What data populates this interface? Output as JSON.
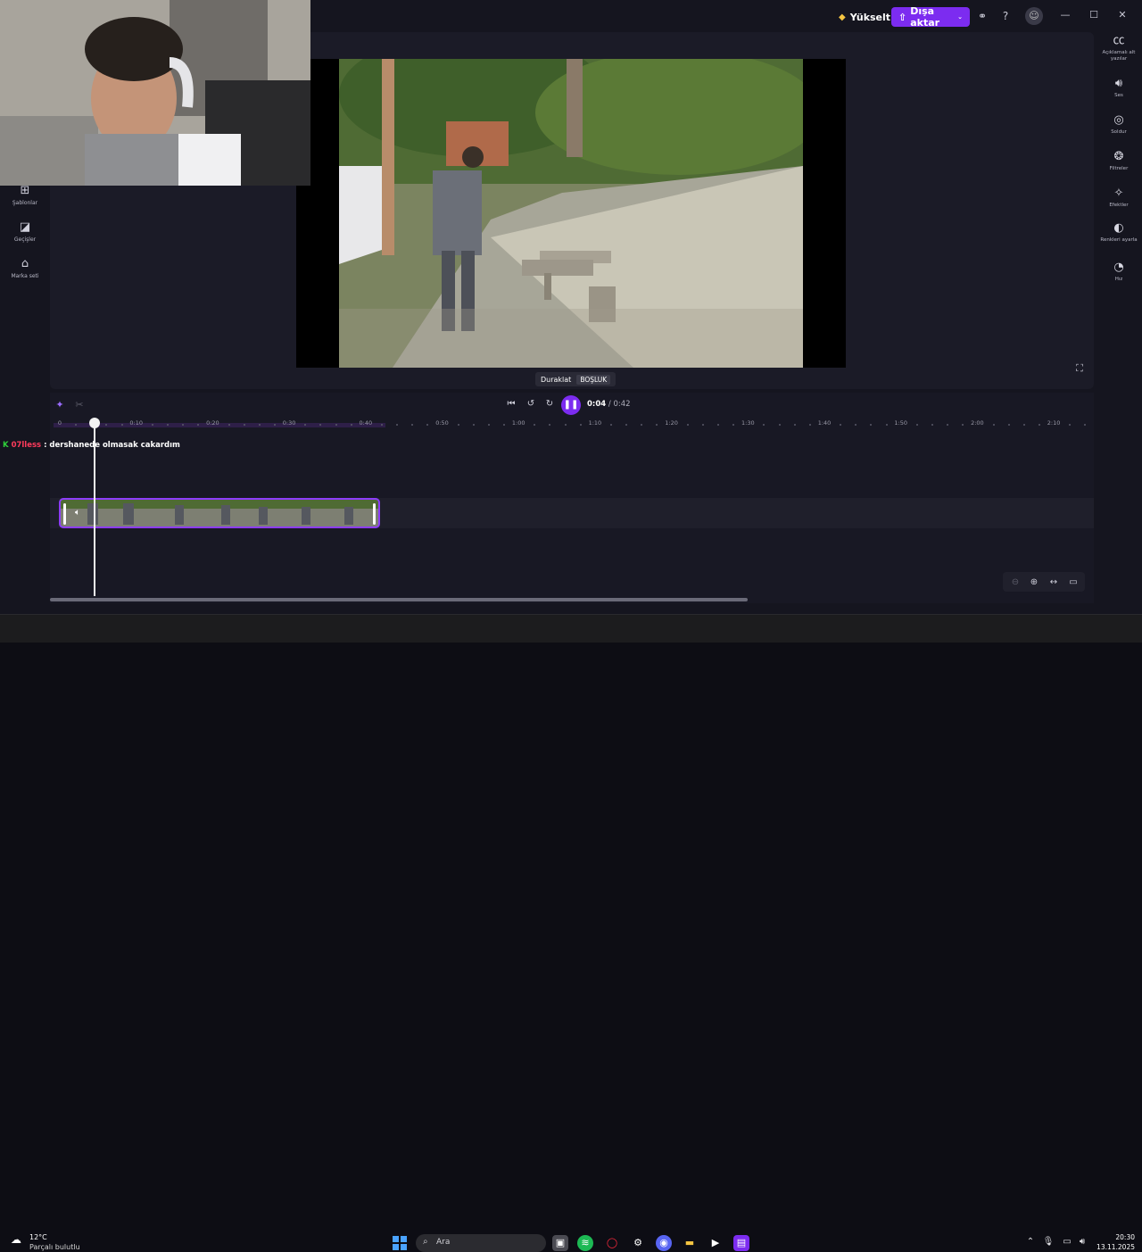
{
  "header": {
    "upgrade_label": "Yükselt",
    "export_label": "Dışa aktar"
  },
  "left_rail": [
    {
      "label": "Şablonlar",
      "icon": "templates-icon"
    },
    {
      "label": "Geçişler",
      "icon": "transitions-icon"
    },
    {
      "label": "Marka seti",
      "icon": "brand-kit-icon"
    }
  ],
  "right_rail": [
    {
      "label": "Açıklamalı alt yazılar",
      "icon": "captions-icon"
    },
    {
      "label": "Ses",
      "icon": "audio-icon"
    },
    {
      "label": "Soldur",
      "icon": "fade-icon"
    },
    {
      "label": "Filtreler",
      "icon": "filters-icon"
    },
    {
      "label": "Efektler",
      "icon": "effects-icon"
    },
    {
      "label": "Renkleri ayarla",
      "icon": "adjust-colors-icon"
    },
    {
      "label": "Hız",
      "icon": "speed-icon"
    }
  ],
  "tooltip": {
    "label": "Duraklat",
    "shortcut": "BOŞLUK"
  },
  "transport": {
    "current_time": "0:04",
    "total_time": "0:42"
  },
  "ruler_labels": [
    "0",
    "0:10",
    "0:20",
    "0:30",
    "0:40",
    "0:50",
    "1:00",
    "1:10",
    "1:20",
    "1:30",
    "1:40",
    "1:50",
    "2:00",
    "2:10"
  ],
  "chat": {
    "user": "07lless",
    "message": ": dershanede olmasak cakardım"
  },
  "taskbar": {
    "temperature": "12°C",
    "weather": "Parçalı bulutlu",
    "search_placeholder": "Ara",
    "time": "20:30",
    "date": "13.11.2025"
  },
  "colors": {
    "accent": "#7c2cf0",
    "clip_border": "#8d3cff",
    "chat_user": "#ff3b5c"
  }
}
